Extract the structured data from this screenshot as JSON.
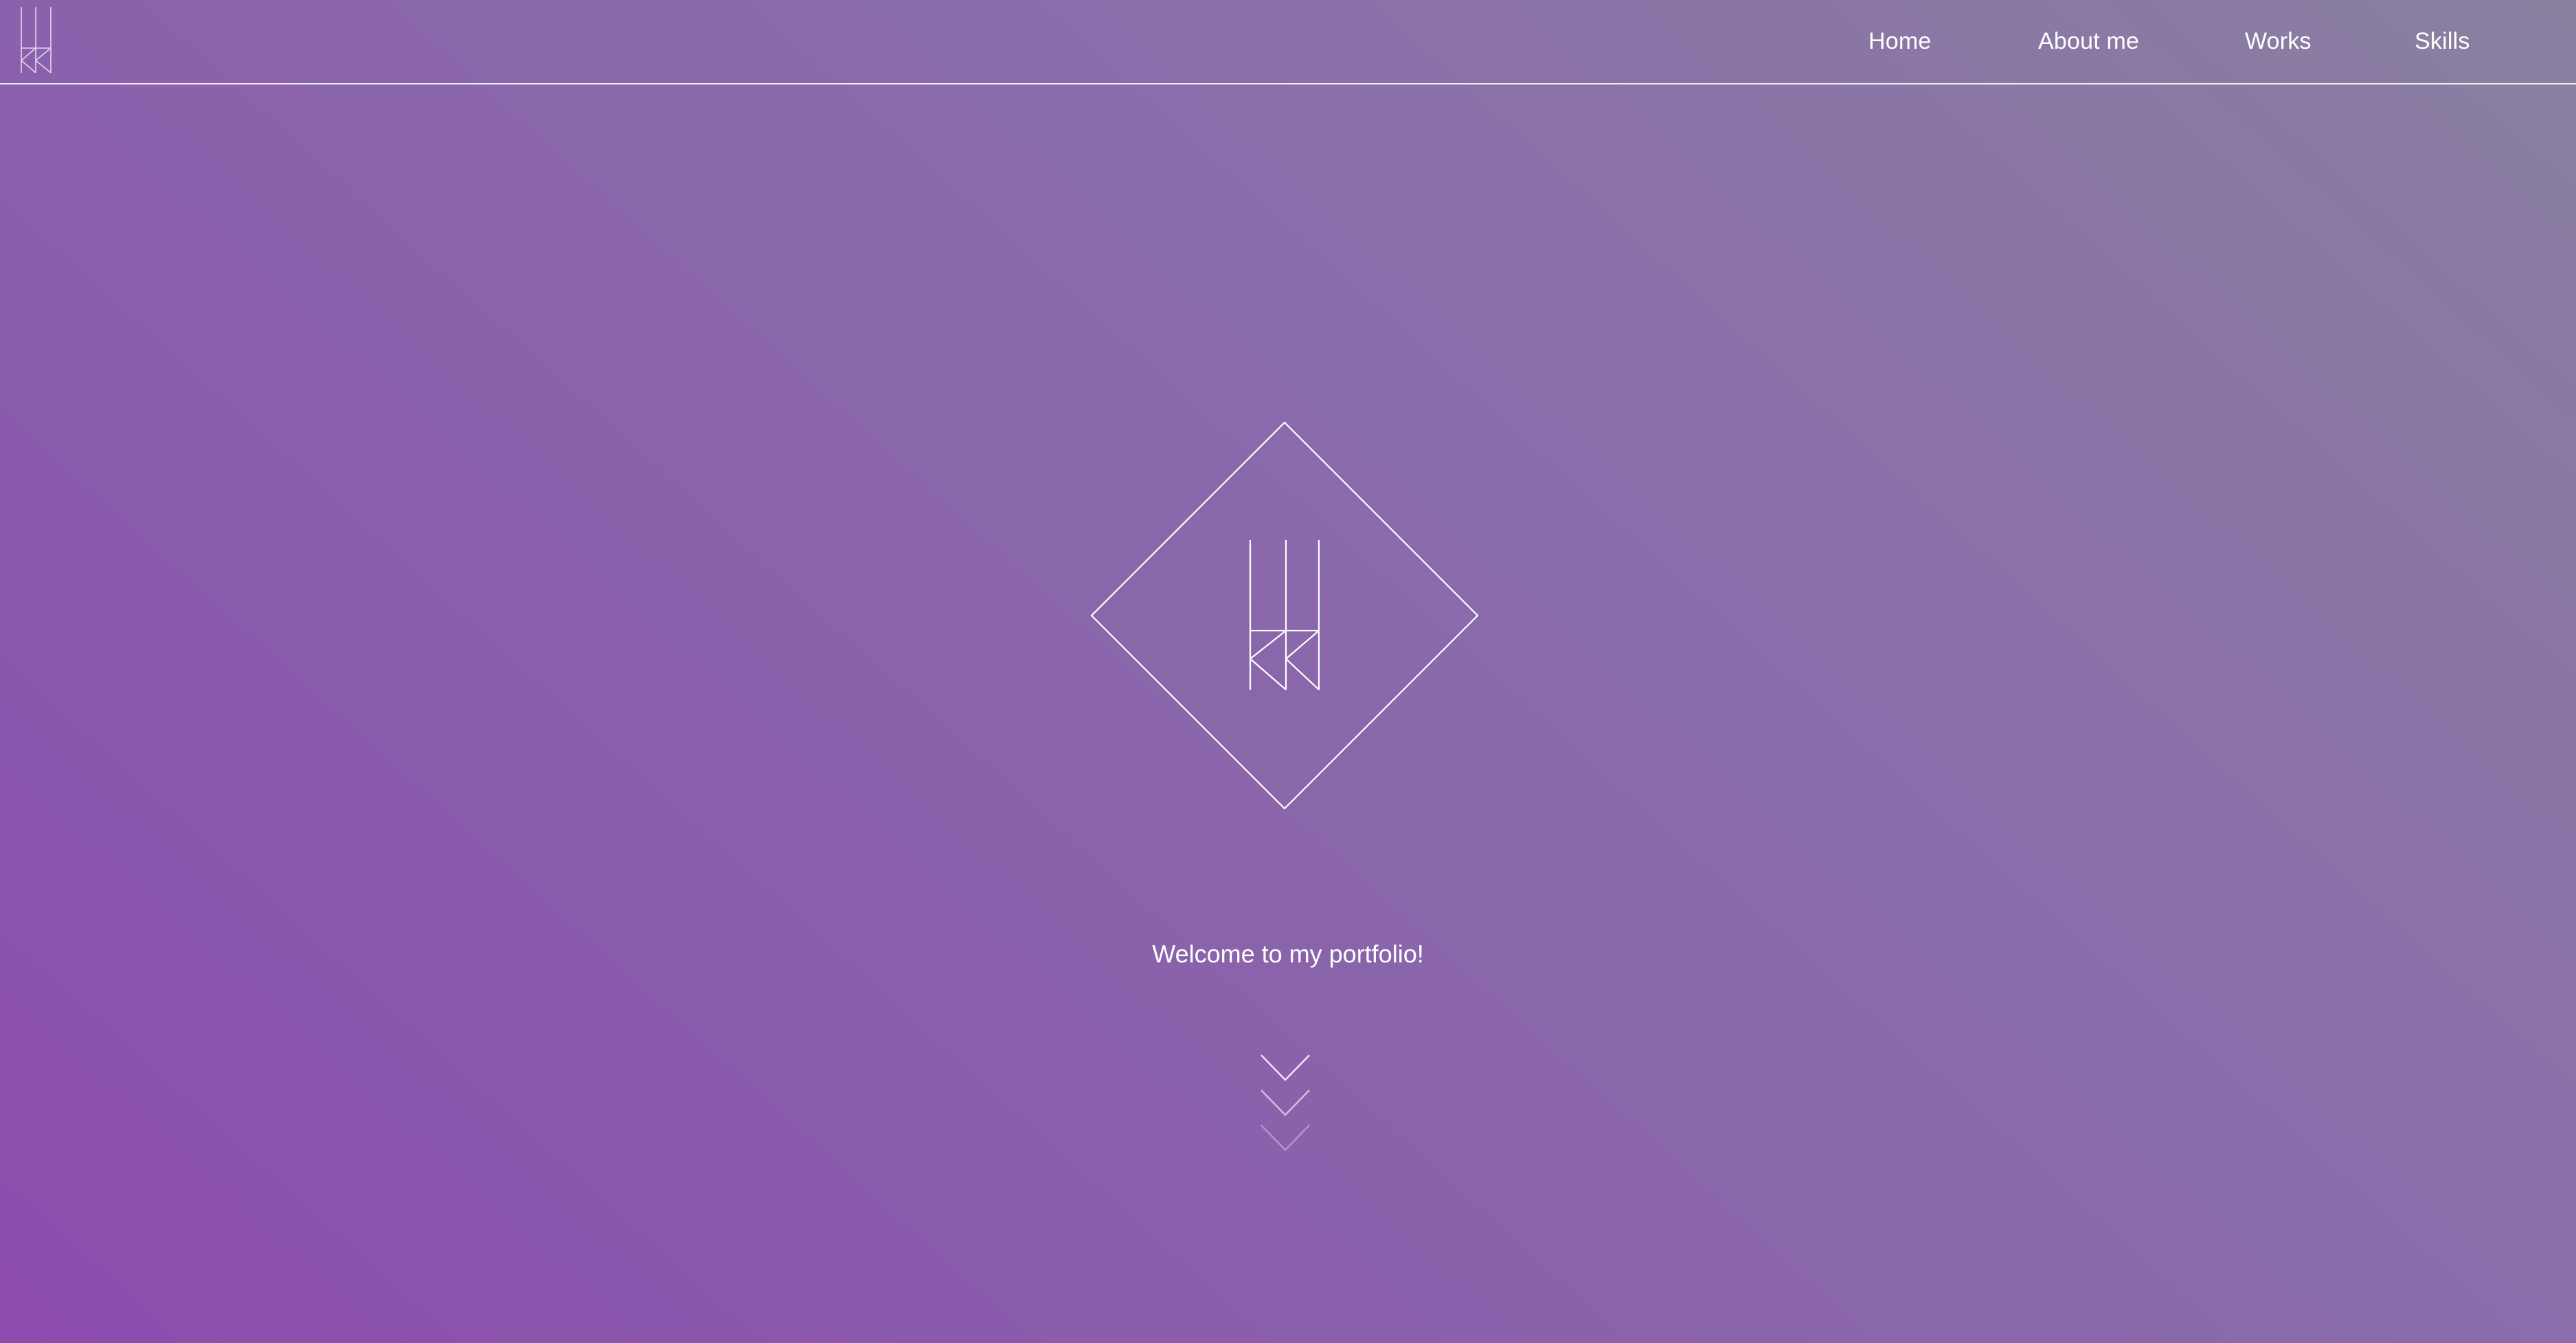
{
  "header": {
    "logo_icon": "kk-monogram-icon",
    "nav": [
      {
        "label": "Home"
      },
      {
        "label": "About me"
      },
      {
        "label": "Works"
      },
      {
        "label": "Skills"
      }
    ]
  },
  "hero": {
    "emblem_icon": "diamond-kk-monogram-icon",
    "welcome_text": "Welcome to my portfolio!",
    "scroll_icon": "triple-chevron-down-icon"
  },
  "colors": {
    "gradient_start": "#8c4cae",
    "gradient_end": "#8a80a0",
    "line": "#ffffff"
  }
}
